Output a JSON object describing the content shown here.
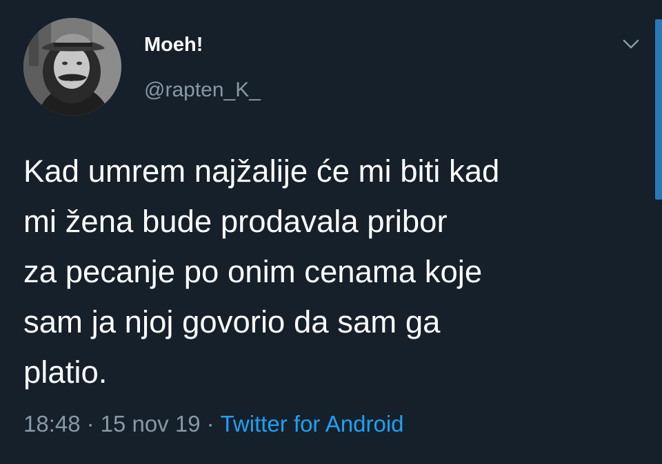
{
  "tweet": {
    "author": {
      "display_name": "Moeh!",
      "handle": "@rapten_K_",
      "avatar_icon": "user-avatar-photo"
    },
    "text": "Kad umrem najžalije će mi biti kad\nmi žena bude prodavala pribor\nza pecanje po onim cenama koje\nsam ja njoj govorio da sam ga\nplatio.",
    "time": "18:48",
    "date": "15 nov 19",
    "separator": "·",
    "source": "Twitter for Android",
    "menu_icon": "chevron-down-icon"
  },
  "colors": {
    "background": "#15202b",
    "primary_text": "#ffffff",
    "secondary_text": "#8899a6",
    "link": "#1da1f2",
    "scrollbar": "#2c77b5"
  }
}
